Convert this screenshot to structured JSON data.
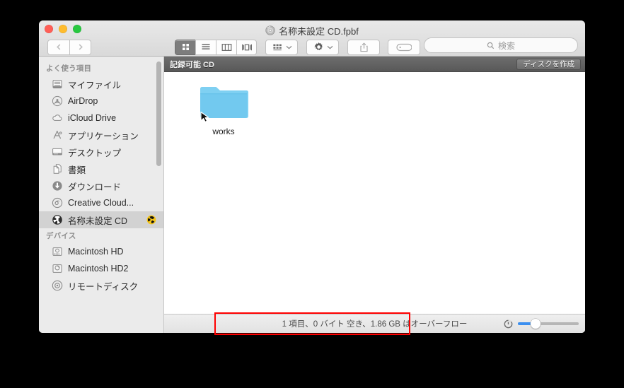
{
  "window": {
    "title": "名称未設定 CD.fpbf",
    "title_icon": "optical-disc-icon",
    "traffic_lights": [
      "close",
      "minimize",
      "zoom"
    ]
  },
  "toolbar": {
    "back_label": "戻る",
    "forward_label": "進む",
    "views": [
      {
        "name": "icon-view",
        "icon": "grid-icon",
        "active": true
      },
      {
        "name": "list-view",
        "icon": "list-icon",
        "active": false
      },
      {
        "name": "column-view",
        "icon": "columns-icon",
        "active": false
      },
      {
        "name": "coverflow-view",
        "icon": "coverflow-icon",
        "active": false
      }
    ],
    "arrange": {
      "name": "arrange-button",
      "icon": "arrange-grid-icon"
    },
    "action": {
      "name": "action-button",
      "icon": "gear-icon"
    },
    "share": {
      "name": "share-button",
      "icon": "share-icon"
    },
    "tags": {
      "name": "tags-button",
      "icon": "tag-icon"
    }
  },
  "search": {
    "placeholder": "検索",
    "value": "",
    "icon": "search-icon"
  },
  "sidebar": {
    "sections": [
      {
        "title": "よく使う項目",
        "items": [
          {
            "label": "マイファイル",
            "icon": "myfiles-icon",
            "selected": false
          },
          {
            "label": "AirDrop",
            "icon": "airdrop-icon",
            "selected": false
          },
          {
            "label": "iCloud Drive",
            "icon": "icloud-icon",
            "selected": false
          },
          {
            "label": "アプリケーション",
            "icon": "applications-icon",
            "selected": false
          },
          {
            "label": "デスクトップ",
            "icon": "desktop-icon",
            "selected": false
          },
          {
            "label": "書類",
            "icon": "documents-icon",
            "selected": false
          },
          {
            "label": "ダウンロード",
            "icon": "downloads-icon",
            "selected": false
          },
          {
            "label": "Creative Cloud...",
            "icon": "creative-cloud-icon",
            "selected": false
          },
          {
            "label": "名称未設定 CD",
            "icon": "burn-disc-icon",
            "selected": true,
            "badge": "burn-badge-icon"
          }
        ]
      },
      {
        "title": "デバイス",
        "items": [
          {
            "label": "Macintosh HD",
            "icon": "hard-drive-icon",
            "selected": false
          },
          {
            "label": "Macintosh HD2",
            "icon": "hard-drive-icon",
            "selected": false
          },
          {
            "label": "リモートディスク",
            "icon": "remote-disc-icon",
            "selected": false
          }
        ]
      }
    ]
  },
  "content": {
    "header_title": "記録可能 CD",
    "burn_button_label": "ディスクを作成",
    "files": [
      {
        "name": "works",
        "icon": "folder-icon",
        "alias": true
      }
    ]
  },
  "statusbar": {
    "text": "1 項目、0 バイト 空き、1.86 GB はオーバーフロー",
    "zoom_icon": "icon-size-icon",
    "zoom_value": 26
  },
  "annotation": {
    "color": "#ff0000",
    "target": "statusbar-text"
  }
}
